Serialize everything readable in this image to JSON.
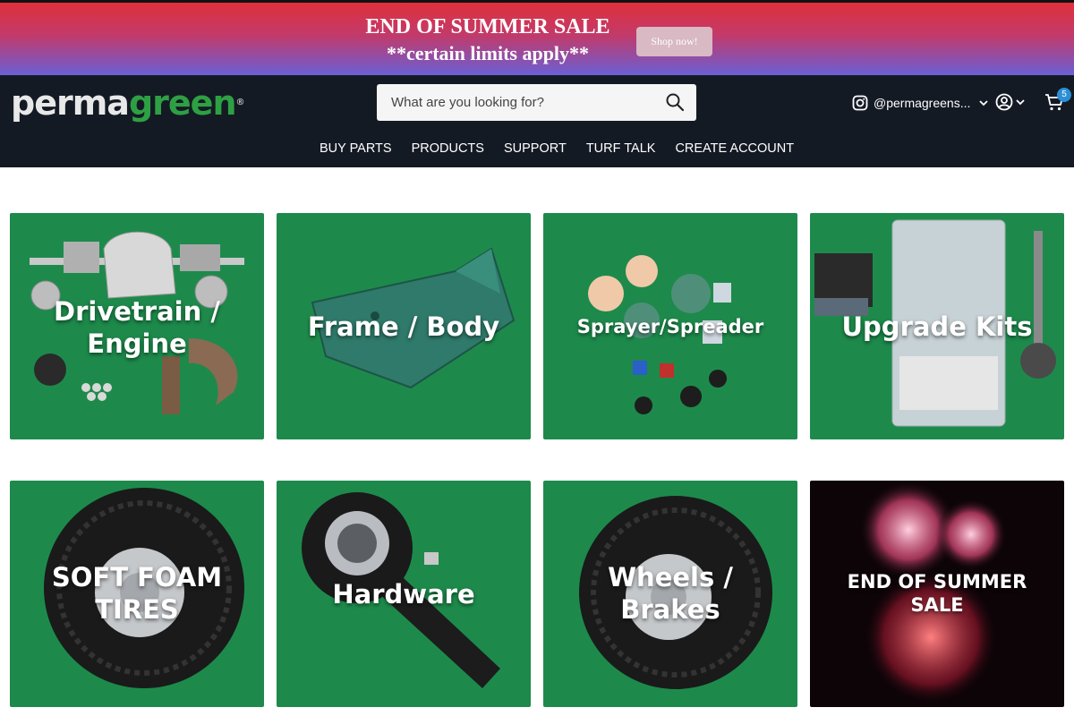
{
  "promo": {
    "line1": "END OF SUMMER SALE",
    "line2": "**certain limits apply**",
    "cta": "Shop now!"
  },
  "header": {
    "logo_perma": "perma",
    "logo_green": "green",
    "logo_reg": "®",
    "search_placeholder": "What are you looking for?",
    "social_handle": "@permagreens...",
    "cart_count": "5",
    "nav": [
      "BUY PARTS",
      "PRODUCTS",
      "SUPPORT",
      "TURF TALK",
      "CREATE ACCOUNT"
    ]
  },
  "tiles": {
    "drivetrain": {
      "line1": "Drivetrain /",
      "line2": "Engine"
    },
    "frame": {
      "line1": "Frame / Body"
    },
    "sprayer": {
      "line1": "Sprayer/Spreader"
    },
    "upgrade": {
      "line1": "Upgrade Kits"
    },
    "softfoam": {
      "line1": "SOFT FOAM",
      "line2": "TIRES"
    },
    "hardware": {
      "line1": "Hardware"
    },
    "wheels": {
      "line1": "Wheels /",
      "line2": "Brakes"
    },
    "sale": {
      "line1": "END OF SUMMER",
      "line2": "SALE"
    }
  },
  "colors": {
    "header_bg": "#141a24",
    "tile_green": "#1d8a4b",
    "badge": "#2a8fd6"
  }
}
